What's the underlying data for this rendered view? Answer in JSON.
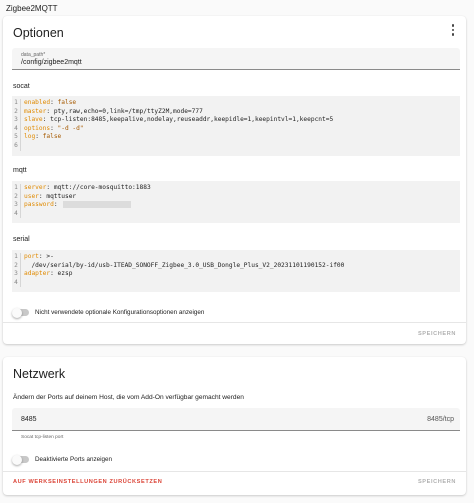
{
  "app": {
    "title": "Zigbee2MQTT"
  },
  "options": {
    "title": "Optionen",
    "data_path": {
      "label": "data_path*",
      "value": "/config/zigbee2mqtt"
    },
    "socat": {
      "label": "socat",
      "lines": [
        {
          "n": "1",
          "key": "enabled",
          "val": "false"
        },
        {
          "n": "2",
          "key": "master",
          "val": "pty,raw,echo=0,link=/tmp/ttyZ2M,mode=777"
        },
        {
          "n": "3",
          "key": "slave",
          "val": "tcp-listen:8485,keepalive,nodelay,reuseaddr,keepidle=1,keepintvl=1,keepcnt=5"
        },
        {
          "n": "4",
          "key": "options",
          "val": "\"-d -d\""
        },
        {
          "n": "5",
          "key": "log",
          "val": "false"
        },
        {
          "n": "6",
          "key": "",
          "val": ""
        }
      ]
    },
    "mqtt": {
      "label": "mqtt",
      "lines": [
        {
          "n": "1",
          "key": "server",
          "val": "mqtt://core-mosquitto:1883"
        },
        {
          "n": "2",
          "key": "user",
          "val": "mqttuser"
        },
        {
          "n": "3",
          "key": "password",
          "val": ""
        },
        {
          "n": "4",
          "key": "",
          "val": ""
        }
      ]
    },
    "serial": {
      "label": "serial",
      "lines": [
        {
          "n": "1",
          "key": "port",
          "val": ">-"
        },
        {
          "n": "2",
          "key": "",
          "val": "  /dev/serial/by-id/usb-ITEAD_SONOFF_Zigbee_3.0_USB_Dongle_Plus_V2_20231101190152-if00"
        },
        {
          "n": "3",
          "key": "adapter",
          "val": "ezsp"
        },
        {
          "n": "4",
          "key": "",
          "val": ""
        }
      ]
    },
    "toggle_label": "Nicht verwendete optionale Konfigurationsoptionen anzeigen",
    "save_label": "SPEICHERN"
  },
  "network": {
    "title": "Netzwerk",
    "description": "Ändern der Ports auf deinem Host, die vom Add-On verfügbar gemacht werden",
    "port_value": "8485",
    "port_suffix": "8485/tcp",
    "port_helper": "Socat tcp-listen port",
    "toggle_label": "Deaktivierte Ports anzeigen",
    "reset_label": "AUF WERKSEINSTELLUNGEN ZURÜCKSETZEN",
    "save_label": "SPEICHERN"
  }
}
